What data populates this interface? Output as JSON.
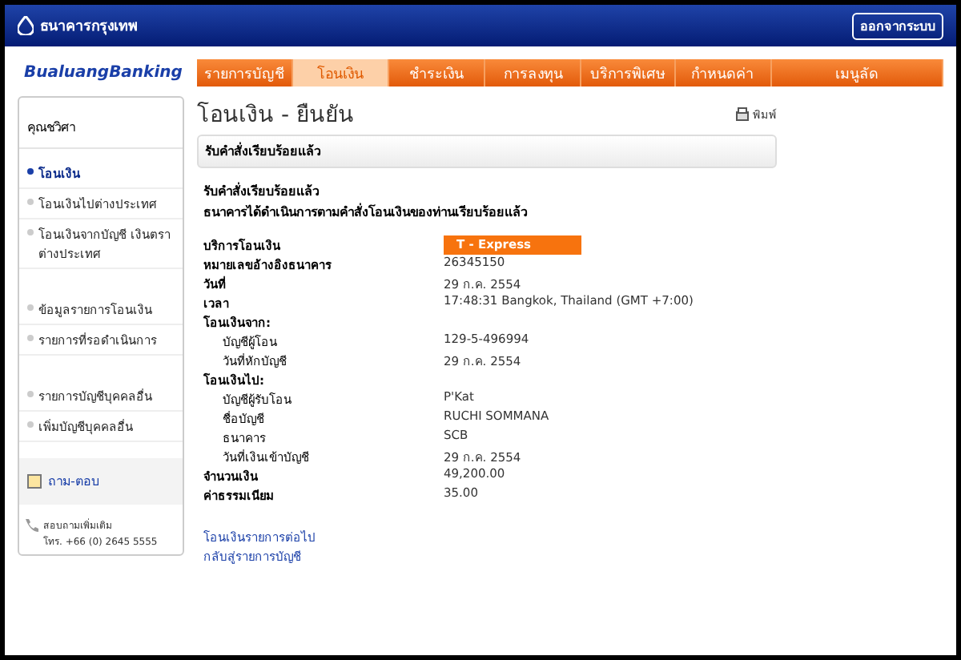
{
  "header": {
    "bank_name": "ธนาคารกรุงเทพ",
    "logout": "ออกจากระบบ"
  },
  "logo": {
    "left": "Bualuang",
    "right": "Banking"
  },
  "nav": [
    {
      "label": "รายการบัญชี",
      "selected": false
    },
    {
      "label": "โอนเงิน",
      "selected": true
    },
    {
      "label": "ชำระเงิน",
      "selected": false
    },
    {
      "label": "การลงทุน",
      "selected": false
    },
    {
      "label": "บริการพิเศษ",
      "selected": false
    },
    {
      "label": "กำหนดค่า",
      "selected": false
    },
    {
      "label": "เมนูลัด",
      "selected": false
    }
  ],
  "sidebar": {
    "user": "คุณชวิศา",
    "groups": [
      [
        {
          "label": "โอนเงิน",
          "selected": true
        },
        {
          "label": "โอนเงินไปต่างประเทศ",
          "selected": false
        },
        {
          "label": "โอนเงินจากบัญชี เงินตราต่างประเทศ",
          "selected": false
        }
      ],
      [
        {
          "label": "ข้อมูลรายการโอนเงิน",
          "selected": false
        },
        {
          "label": "รายการที่รอดำเนินการ",
          "selected": false
        }
      ],
      [
        {
          "label": "รายการบัญชีบุคคลอื่น",
          "selected": false
        },
        {
          "label": "เพิ่มบัญชีบุคคลอื่น",
          "selected": false
        }
      ]
    ],
    "faq": "ถาม-ตอบ",
    "contact_title": "สอบถามเพิ่มเติม",
    "contact_phone": "โทร. +66 (0) 2645 5555"
  },
  "page": {
    "title": "โอนเงิน - ยืนยัน",
    "print": "พิมพ์",
    "panel_title": "รับคำสั่งเรียบร้อยแล้ว",
    "message": [
      "รับคำสั่งเรียบร้อยแล้ว",
      "ธนาคารได้ดำเนินการตามคำสั่งโอนเงินของท่านเรียบร้อยแล้ว"
    ],
    "details": [
      {
        "kind": "badge",
        "label": "บริการโอนเงิน",
        "value": "T - Express"
      },
      {
        "kind": "row",
        "label": "หมายเลขอ้างอิงธนาคาร",
        "value": "26345150"
      },
      {
        "kind": "row",
        "label": "วันที่",
        "value": "29 ก.ค. 2554"
      },
      {
        "kind": "row",
        "label": "เวลา",
        "value": "17:48:31 Bangkok, Thailand (GMT +7:00)"
      },
      {
        "kind": "section",
        "label": "โอนเงินจาก:"
      },
      {
        "kind": "sub",
        "label": "บัญชีผู้โอน",
        "value": "129-5-496994"
      },
      {
        "kind": "sub",
        "label": "วันที่หักบัญชี",
        "value": "29 ก.ค. 2554"
      },
      {
        "kind": "section",
        "label": "โอนเงินไป:"
      },
      {
        "kind": "sub",
        "label": "บัญชีผู้รับโอน",
        "value": "P'Kat"
      },
      {
        "kind": "sub",
        "label": "ชื่อบัญชี",
        "value": "RUCHI SOMMANA"
      },
      {
        "kind": "sub",
        "label": "ธนาคาร",
        "value": "SCB"
      },
      {
        "kind": "sub",
        "label": "วันที่เงินเข้าบัญชี",
        "value": "29 ก.ค. 2554"
      },
      {
        "kind": "row",
        "label": "จำนวนเงิน",
        "value": "49,200.00"
      },
      {
        "kind": "row",
        "label": "ค่าธรรมเนียม",
        "value": "35.00"
      }
    ],
    "links": [
      "โอนเงินรายการต่อไป",
      "กลับสู่รายการบัญชี"
    ]
  }
}
